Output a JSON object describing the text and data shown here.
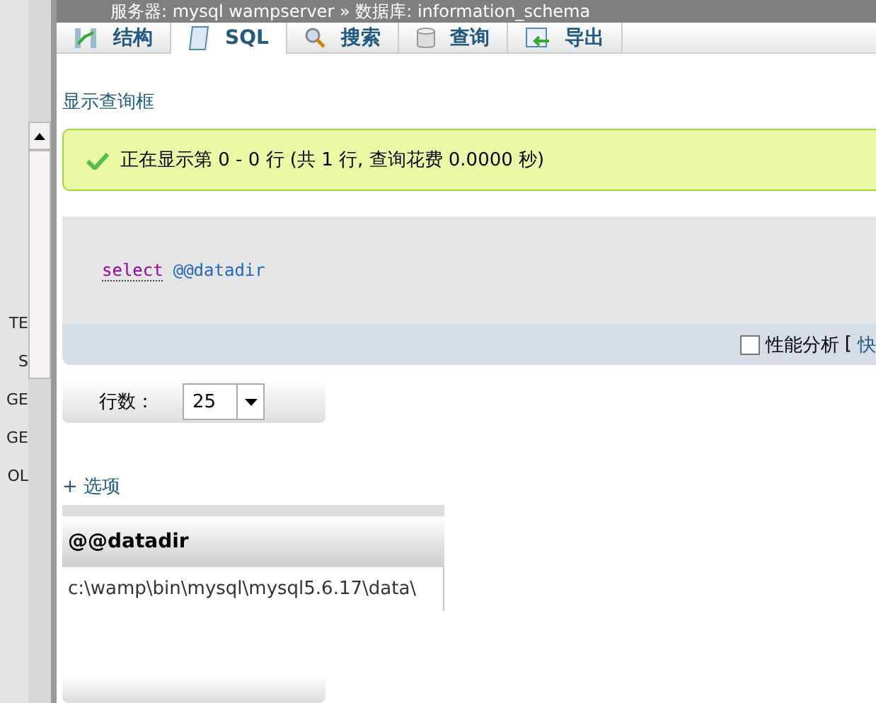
{
  "breadcrumb": "服务器: mysql wampserver » 数据库: information_schema",
  "sidebar": {
    "items": [
      "TE",
      "S",
      "GE",
      "GE",
      "OL"
    ]
  },
  "tabs": [
    {
      "label": "结构",
      "kind": "structure",
      "selected": false
    },
    {
      "label": "SQL",
      "kind": "sql",
      "selected": true
    },
    {
      "label": "搜索",
      "kind": "search",
      "selected": false
    },
    {
      "label": "查询",
      "kind": "query",
      "selected": false
    },
    {
      "label": "导出",
      "kind": "export",
      "selected": false
    }
  ],
  "show_query_link": "显示查询框",
  "message": "正在显示第 0 - 0 行 (共 1 行, 查询花费 0.0000 秒)",
  "query": {
    "keyword": "select",
    "rest": "@@datadir"
  },
  "profiling": {
    "label": "性能分析",
    "checked": false,
    "extra_open": "[",
    "extra_link": "快"
  },
  "rows": {
    "label": "行数：",
    "value": "25"
  },
  "options_link": "+ 选项",
  "table": {
    "columns": [
      "@@datadir"
    ],
    "rows": [
      [
        "c:\\wamp\\bin\\mysql\\mysql5.6.17\\data\\"
      ]
    ]
  }
}
